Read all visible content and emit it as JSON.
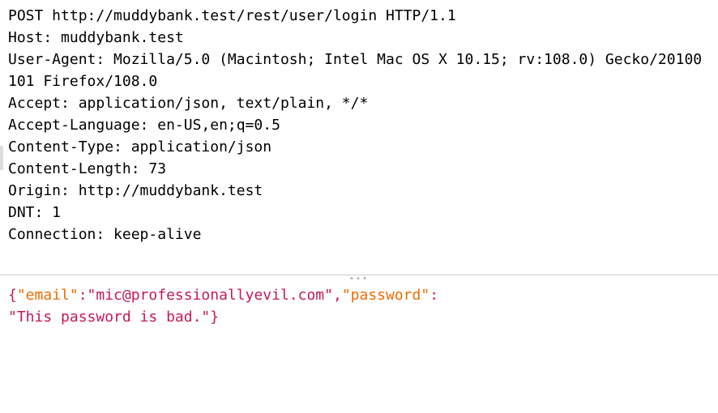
{
  "request": {
    "line": "POST http://muddybank.test/rest/user/login HTTP/1.1",
    "headers": [
      "Host: muddybank.test",
      "User-Agent: Mozilla/5.0 (Macintosh; Intel Mac OS X 10.15; rv:108.0) Gecko/20100101 Firefox/108.0",
      "Accept: application/json, text/plain, */*",
      "Accept-Language: en-US,en;q=0.5",
      "Content-Type: application/json",
      "Content-Length: 73",
      "Origin: http://muddybank.test",
      "DNT: 1",
      "Connection: keep-alive"
    ]
  },
  "body": {
    "open_brace": "{",
    "key_email": "\"email\"",
    "colon1": ":",
    "val_email": "\"mic@professionallyevil.com\"",
    "comma": ",",
    "key_password": "\"password\"",
    "colon2": ":",
    "val_password": "\"This password is bad.\"",
    "close_brace": "}"
  },
  "grip": "•••"
}
